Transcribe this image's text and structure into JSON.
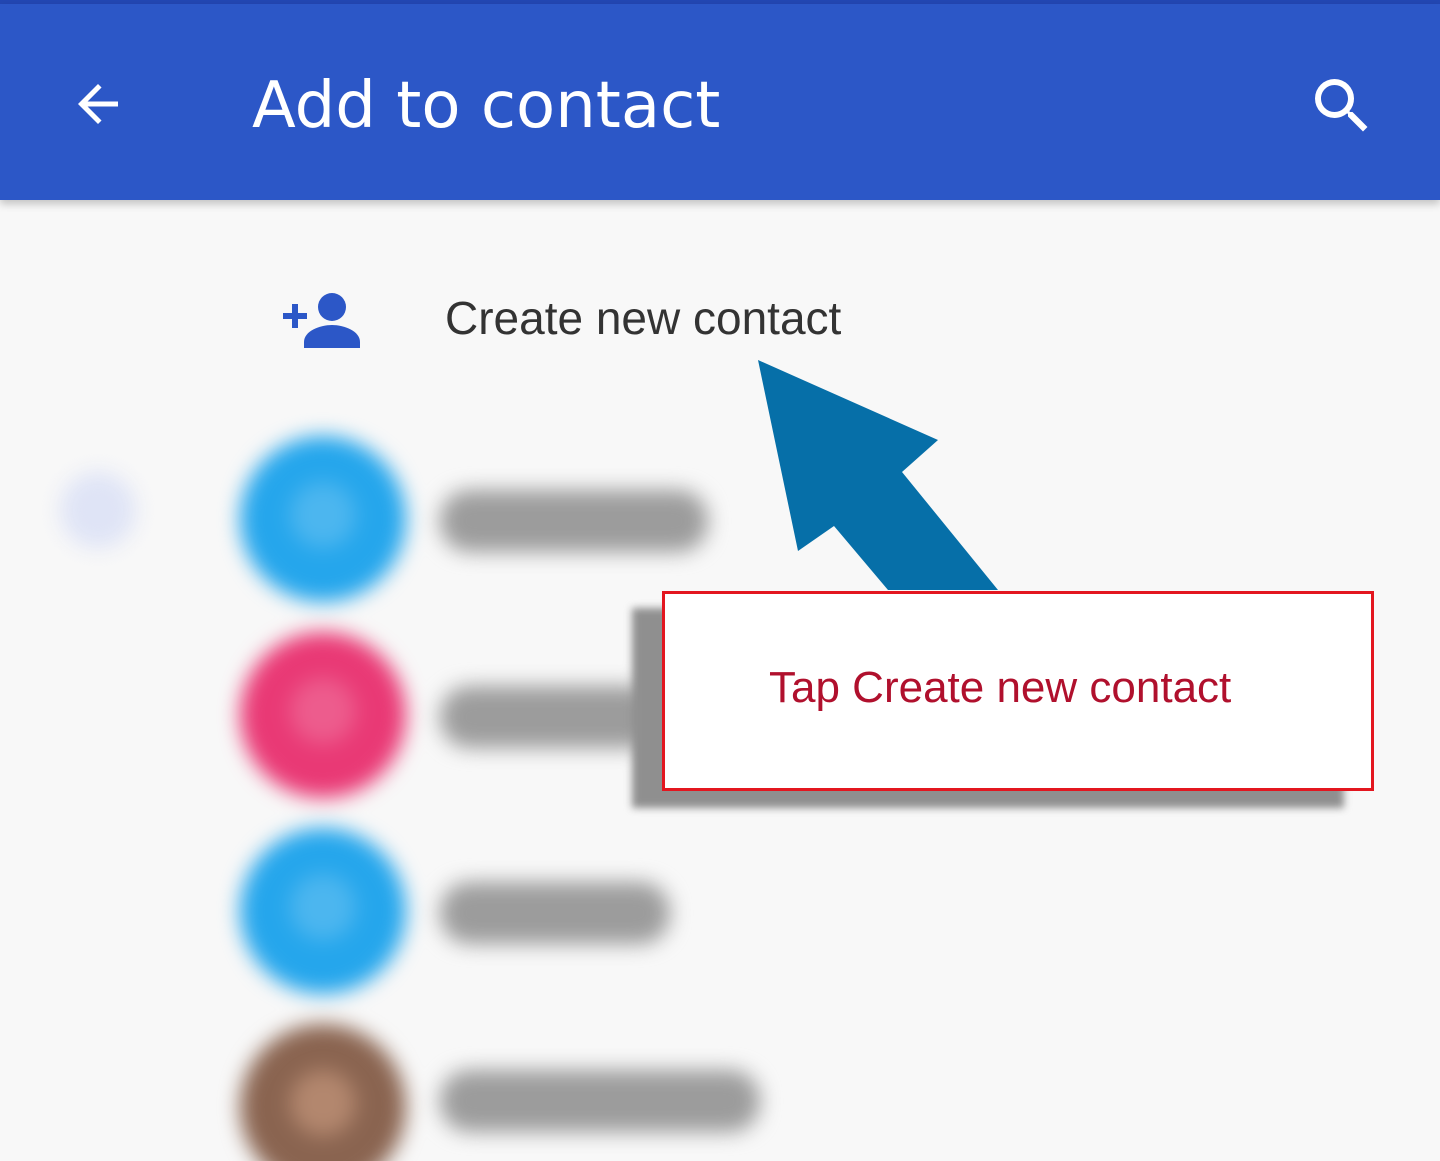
{
  "appbar": {
    "title": "Add to contact",
    "back_icon": "arrow-back-icon",
    "search_icon": "search-icon",
    "color": "#2c57c7"
  },
  "create_contact": {
    "label": "Create new contact",
    "icon": "add-person-icon",
    "icon_color": "#2c57c7"
  },
  "contacts": [
    {
      "avatar_color": "#25a6ec"
    },
    {
      "avatar_color": "#e93975"
    },
    {
      "avatar_color": "#25a6ec"
    },
    {
      "avatar_color": "#8a6450"
    }
  ],
  "annotation": {
    "callout_text": "Tap Create new contact",
    "arrow_color": "#066fa8",
    "border_color": "#e3161f",
    "text_color": "#b0102d"
  }
}
